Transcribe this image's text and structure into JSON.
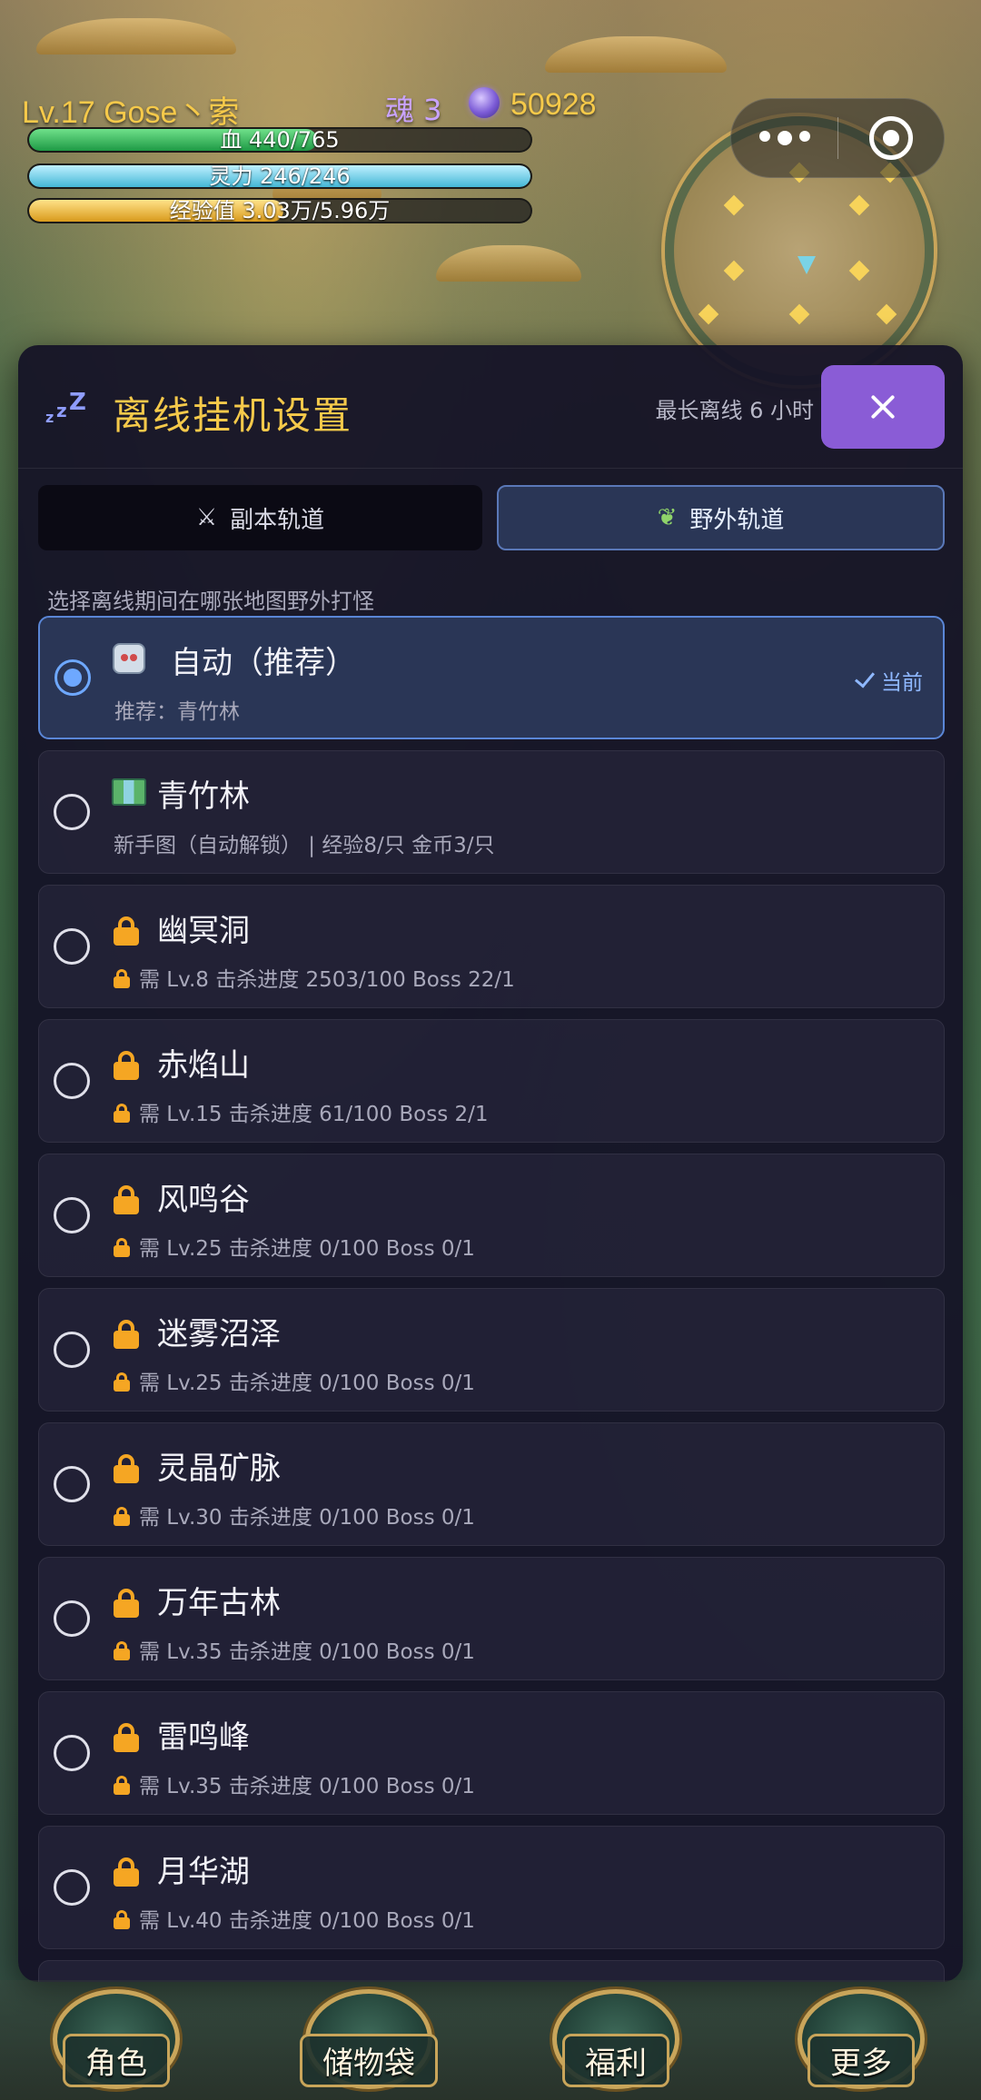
{
  "hud": {
    "player_name": "Lv.17 Gose丶索",
    "soul": "魂 3",
    "gold": "50928",
    "hp_text": "血 440/765",
    "hp_ratio": 0.575,
    "mp_text": "灵力 246/246",
    "mp_ratio": 1.0,
    "xp_text": "经验值 3.03万/5.96万",
    "xp_ratio": 0.508
  },
  "panel": {
    "title": "离线挂机设置",
    "max_offline": "最长离线 6 小时",
    "close_icon": "close-icon",
    "tabs": [
      {
        "label": "副本轨道",
        "icon": "crossed-swords-icon",
        "active": false
      },
      {
        "label": "野外轨道",
        "icon": "leaf-icon",
        "active": true
      }
    ],
    "section_hint": "选择离线期间在哪张地图野外打怪",
    "items": [
      {
        "name": "自动（推荐）",
        "desc": "推荐：青竹林",
        "icon": "robot-icon",
        "selected": true,
        "badge": "当前"
      },
      {
        "name": "青竹林",
        "desc": "新手图（自动解锁） | 经验8/只 金币3/只",
        "icon": "map-icon",
        "selected": false
      },
      {
        "name": "幽冥洞",
        "desc": "需 Lv.8  击杀进度 2503/100 Boss 22/1",
        "icon": "lock-icon",
        "selected": false
      },
      {
        "name": "赤焰山",
        "desc": "需 Lv.15  击杀进度 61/100 Boss 2/1",
        "icon": "lock-icon",
        "selected": false
      },
      {
        "name": "风鸣谷",
        "desc": "需 Lv.25  击杀进度 0/100 Boss 0/1",
        "icon": "lock-icon",
        "selected": false
      },
      {
        "name": "迷雾沼泽",
        "desc": "需 Lv.25  击杀进度 0/100 Boss 0/1",
        "icon": "lock-icon",
        "selected": false
      },
      {
        "name": "灵晶矿脉",
        "desc": "需 Lv.30  击杀进度 0/100 Boss 0/1",
        "icon": "lock-icon",
        "selected": false
      },
      {
        "name": "万年古林",
        "desc": "需 Lv.35  击杀进度 0/100 Boss 0/1",
        "icon": "lock-icon",
        "selected": false
      },
      {
        "name": "雷鸣峰",
        "desc": "需 Lv.35  击杀进度 0/100 Boss 0/1",
        "icon": "lock-icon",
        "selected": false
      },
      {
        "name": "月华湖",
        "desc": "需 Lv.40  击杀进度 0/100 Boss 0/1",
        "icon": "lock-icon",
        "selected": false
      }
    ]
  },
  "bottom_nav": [
    {
      "label": "角色"
    },
    {
      "label": "储物袋"
    },
    {
      "label": "福利"
    },
    {
      "label": "更多"
    }
  ]
}
